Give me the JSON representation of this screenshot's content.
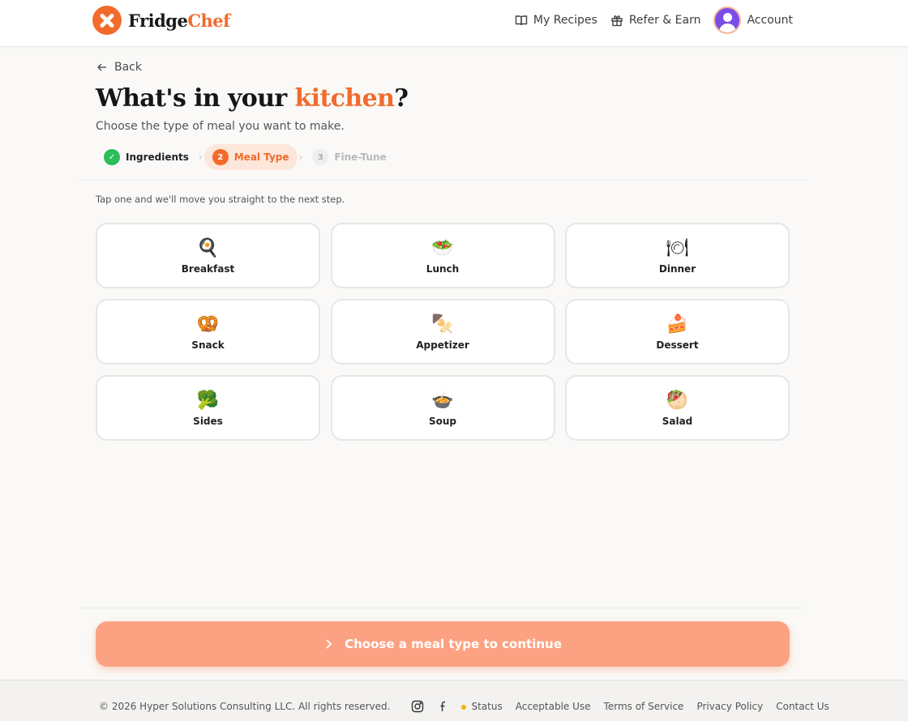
{
  "header": {
    "logo": {
      "part1": "Fridge",
      "part2": "Chef"
    },
    "nav": {
      "my_recipes": "My Recipes",
      "refer": "Refer & Earn",
      "account": "Account"
    }
  },
  "page": {
    "back": "Back",
    "title_pre": "What's in your ",
    "title_accent": "kitchen",
    "title_post": "?",
    "subtitle": "Choose the type of meal you want to make.",
    "hint": "Tap one and we'll move you straight to the next step."
  },
  "steps": [
    {
      "num": "",
      "label": "Ingredients",
      "state": "done"
    },
    {
      "num": "2",
      "label": "Meal Type",
      "state": "active"
    },
    {
      "num": "3",
      "label": "Fine-Tune",
      "state": "pending"
    }
  ],
  "meal_types": [
    {
      "label": "Breakfast",
      "emoji": "🍳"
    },
    {
      "label": "Lunch",
      "emoji": "🥗"
    },
    {
      "label": "Dinner",
      "emoji": "🍽"
    },
    {
      "label": "Snack",
      "emoji": "🥨"
    },
    {
      "label": "Appetizer",
      "emoji": "🍢"
    },
    {
      "label": "Dessert",
      "emoji": "🍰"
    },
    {
      "label": "Sides",
      "emoji": "🥦"
    },
    {
      "label": "Soup",
      "emoji": "🍲"
    },
    {
      "label": "Salad",
      "emoji": "🥙"
    }
  ],
  "cta": {
    "label": "Choose a meal type to continue"
  },
  "footer": {
    "copyright": "© 2026 Hyper Solutions Consulting LLC. All rights reserved.",
    "status": "Status",
    "links": [
      "Acceptable Use",
      "Terms of Service",
      "Privacy Policy",
      "Contact Us"
    ]
  },
  "colors": {
    "accent": "#f26b2c",
    "cta_bg": "#fca283",
    "success": "#2bbd5a",
    "avatar": "#7b4de8"
  }
}
